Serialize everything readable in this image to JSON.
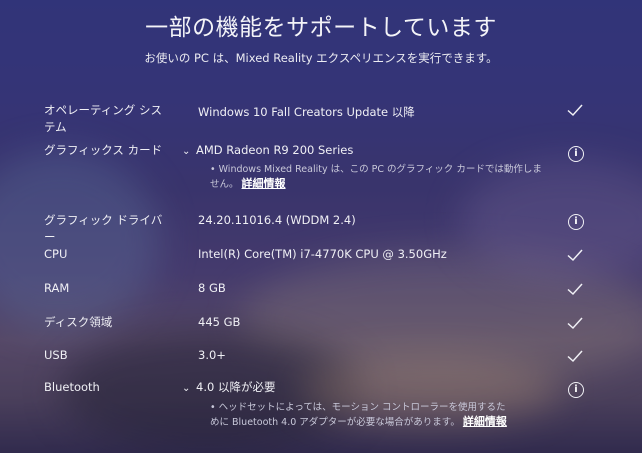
{
  "header": {
    "title": "一部の機能をサポートしています",
    "subtitle": "お使いの PC は、Mixed Reality エクスペリエンスを実行できます。"
  },
  "rows": [
    {
      "label": "オペレーティング システム",
      "value": "Windows 10 Fall Creators Update 以降",
      "status": "check"
    },
    {
      "label": "グラフィックス カード",
      "value": "AMD Radeon R9 200 Series",
      "status": "info",
      "detail": "• Windows Mixed Reality は、この PC のグラフィック カードでは動作しません。",
      "more": "詳細情報"
    },
    {
      "label": "グラフィック ドライバー",
      "value": "24.20.11016.4 (WDDM 2.4)",
      "status": "info"
    },
    {
      "label": "CPU",
      "value": "Intel(R) Core(TM) i7-4770K CPU @ 3.50GHz",
      "status": "check"
    },
    {
      "label": "RAM",
      "value": "8 GB",
      "status": "check"
    },
    {
      "label": "ディスク領域",
      "value": "445 GB",
      "status": "check"
    },
    {
      "label": "USB",
      "value": "3.0+",
      "status": "check"
    },
    {
      "label": "Bluetooth",
      "value": "4.0 以降が必要",
      "status": "info",
      "detail": "• ヘッドセットによっては、モーション コントローラーを使用するために Bluetooth 4.0 アダプターが必要な場合があります。",
      "more": "詳細情報"
    }
  ],
  "icons": {
    "check": "checkmark-icon",
    "info": "info-icon",
    "chevron": "chevron-down-icon"
  },
  "colors": {
    "text": "#ffffff",
    "detail": "#c9c9da"
  }
}
